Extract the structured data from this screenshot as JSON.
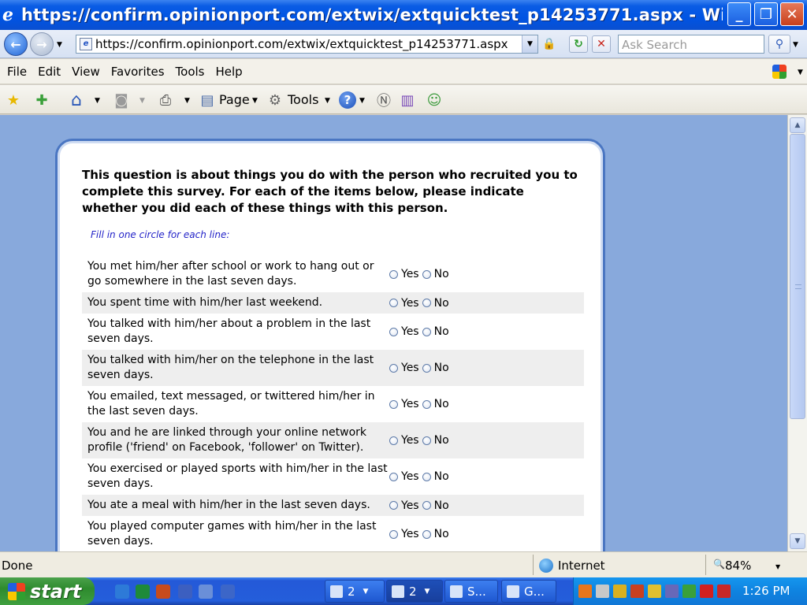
{
  "window": {
    "title": "https://confirm.opinionport.com/extwix/extquicktest_p14253771.aspx - Wi...",
    "ie_glyph": "e",
    "min_glyph": "_",
    "max_glyph": "❐",
    "close_glyph": "✕"
  },
  "address_bar": {
    "url": "https://confirm.opinionport.com/extwix/extquicktest_p14253771.aspx",
    "search_placeholder": "Ask Search",
    "back_glyph": "←",
    "forward_glyph": "→",
    "dropdown_glyph": "▼",
    "page_glyph": "e",
    "lock_glyph": "🔒",
    "refresh_glyph": "↻",
    "stop_glyph": "✕",
    "search_glyph": "⚲"
  },
  "menu": {
    "items": [
      "File",
      "Edit",
      "View",
      "Favorites",
      "Tools",
      "Help"
    ]
  },
  "command_bar": {
    "page_label": "Page",
    "tools_label": "Tools",
    "dropdown_glyph": "▼",
    "favorites_glyph": "★",
    "add_favorites_glyph": "✚",
    "home_glyph": "⌂",
    "feeds_glyph": "◙",
    "print_glyph": "⎙",
    "page_glyph": "▤",
    "tools_glyph": "⚙",
    "help_glyph": "?",
    "research_glyph": "Ⓝ",
    "translate_glyph": "▥",
    "messenger_glyph": "☺"
  },
  "survey": {
    "question": "This question is about things you do with the person who recruited you to complete this survey. For each of the items below, please indicate whether you did each of these things with this person.",
    "instruction": "Fill in one circle for each line:",
    "yes_label": "Yes",
    "no_label": "No",
    "items": [
      "You met him/her after school or work to hang out or go somewhere in the last seven days.",
      "You spent time with him/her last weekend.",
      "You talked with him/her about a problem in the last seven days.",
      "You talked with him/her on the telephone in the last seven days.",
      "You emailed, text messaged, or twittered him/her in the last seven days.",
      "You and he are linked through your online network profile ('friend' on Facebook, 'follower' on Twitter).",
      "You exercised or played sports with him/her in the last seven days.",
      "You ate a meal with him/her in the last seven days.",
      "You played computer games with him/her in the last seven days."
    ]
  },
  "scrollbar": {
    "up_glyph": "▲",
    "down_glyph": "▼"
  },
  "status_bar": {
    "status": "Done",
    "zone": "Internet",
    "zoom": "84%",
    "zoom_glyph": "🔍",
    "dropdown_glyph": "▼"
  },
  "taskbar": {
    "start_label": "start",
    "tasks": [
      {
        "label": "2"
      },
      {
        "label": "2"
      },
      {
        "label": "S..."
      },
      {
        "label": "G..."
      }
    ],
    "dropdown_glyph": "▼",
    "clock": "1:26 PM",
    "tray_colors": [
      "#e8761c",
      "#c8c8c8",
      "#d9b020",
      "#c84020",
      "#e0c030",
      "#6868b8",
      "#3aa03a",
      "#d02020",
      "#c82828"
    ],
    "quicklaunch_colors": [
      "#2d7ad8",
      "#1e8a3a",
      "#c84b1c",
      "#3c5fc0",
      "#6a8fd8",
      "#3c66c8"
    ]
  }
}
